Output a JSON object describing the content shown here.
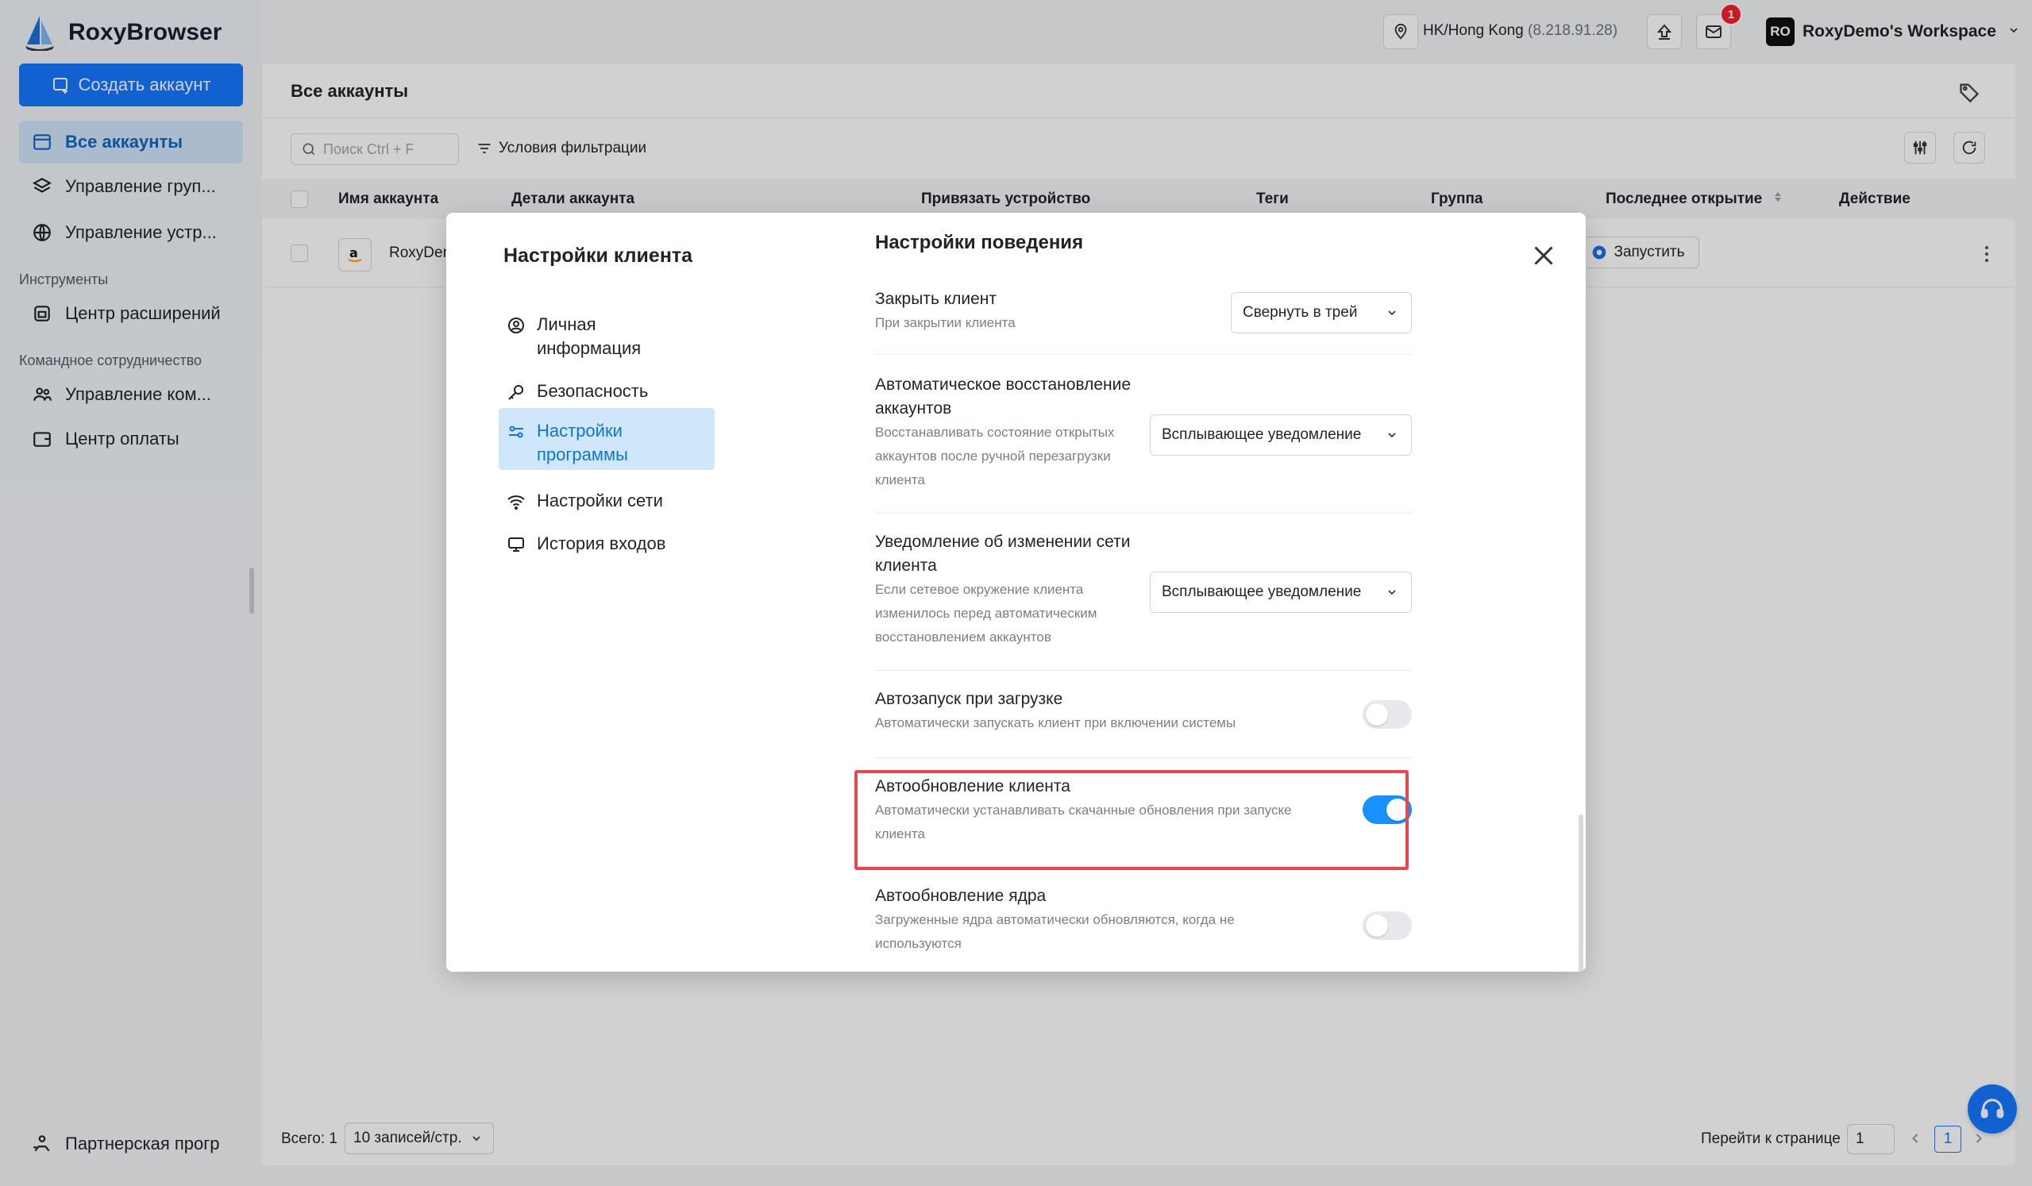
{
  "app": {
    "name": "RoxyBrowser",
    "create_button": "Создать аккаунт",
    "nav": {
      "all_accounts": "Все аккаунты",
      "group_management": "Управление груп...",
      "device_management": "Управление устр...",
      "tools_section": "Инструменты",
      "extensions_center": "Центр расширений",
      "team_section": "Командное сотрудничество",
      "team_management": "Управление ком...",
      "payment_center": "Центр оплаты",
      "partner_program": "Партнерская прогр"
    }
  },
  "topbar": {
    "location": "HK/Hong Kong",
    "ip": "(8.218.91.28)",
    "notification_count": "1",
    "workspace_initials": "RO",
    "workspace_name": "RoxyDemo's Workspace"
  },
  "content": {
    "title": "Все аккаунты",
    "search_placeholder": "Поиск Ctrl + F",
    "filter_label": "Условия фильтрации",
    "columns": [
      "Имя аккаунта",
      "Детали аккаунта",
      "Привязать устройство",
      "Теги",
      "Группа",
      "Последнее открытие",
      "Действие"
    ],
    "row": {
      "name": "RoxyDem",
      "last_open": "--",
      "launch": "Запустить"
    },
    "footer": {
      "total": "Всего: 1",
      "page_size": "10 записей/стр.",
      "goto": "Перейти к странице",
      "page_input": "1",
      "current_page": "1"
    }
  },
  "modal": {
    "title": "Настройки клиента",
    "nav": [
      {
        "label": "Личная информация"
      },
      {
        "label": "Безопасность"
      },
      {
        "label": "Настройки программы"
      },
      {
        "label": "Настройки сети"
      },
      {
        "label": "История входов"
      }
    ],
    "section_title": "Настройки поведения",
    "settings": {
      "close_client": {
        "label": "Закрыть клиент",
        "desc": "При закрытии клиента",
        "value": "Свернуть в трей"
      },
      "auto_restore": {
        "label": "Автоматическое восстановление аккаунтов",
        "desc": "Восстанавливать состояние открытых аккаунтов после ручной перезагрузки клиента",
        "value": "Всплывающее уведомление"
      },
      "network_change": {
        "label": "Уведомление об изменении сети клиента",
        "desc": "Если сетевое окружение клиента изменилось перед автоматическим восстановлением аккаунтов",
        "value": "Всплывающее уведомление"
      },
      "autostart": {
        "label": "Автозапуск при загрузке",
        "desc": "Автоматически запускать клиент при включении системы",
        "enabled": false
      },
      "auto_update_client": {
        "label": "Автообновление клиента",
        "desc": "Автоматически устанавливать скачанные обновления при запуске клиента",
        "enabled": true
      },
      "auto_update_core": {
        "label": "Автообновление ядра",
        "desc": "Загруженные ядра автоматически обновляются, когда не используются",
        "enabled": false
      }
    }
  },
  "colors": {
    "accent": "#1677ff",
    "highlight": "#e8474c",
    "toggle_on": "#1890ff"
  }
}
